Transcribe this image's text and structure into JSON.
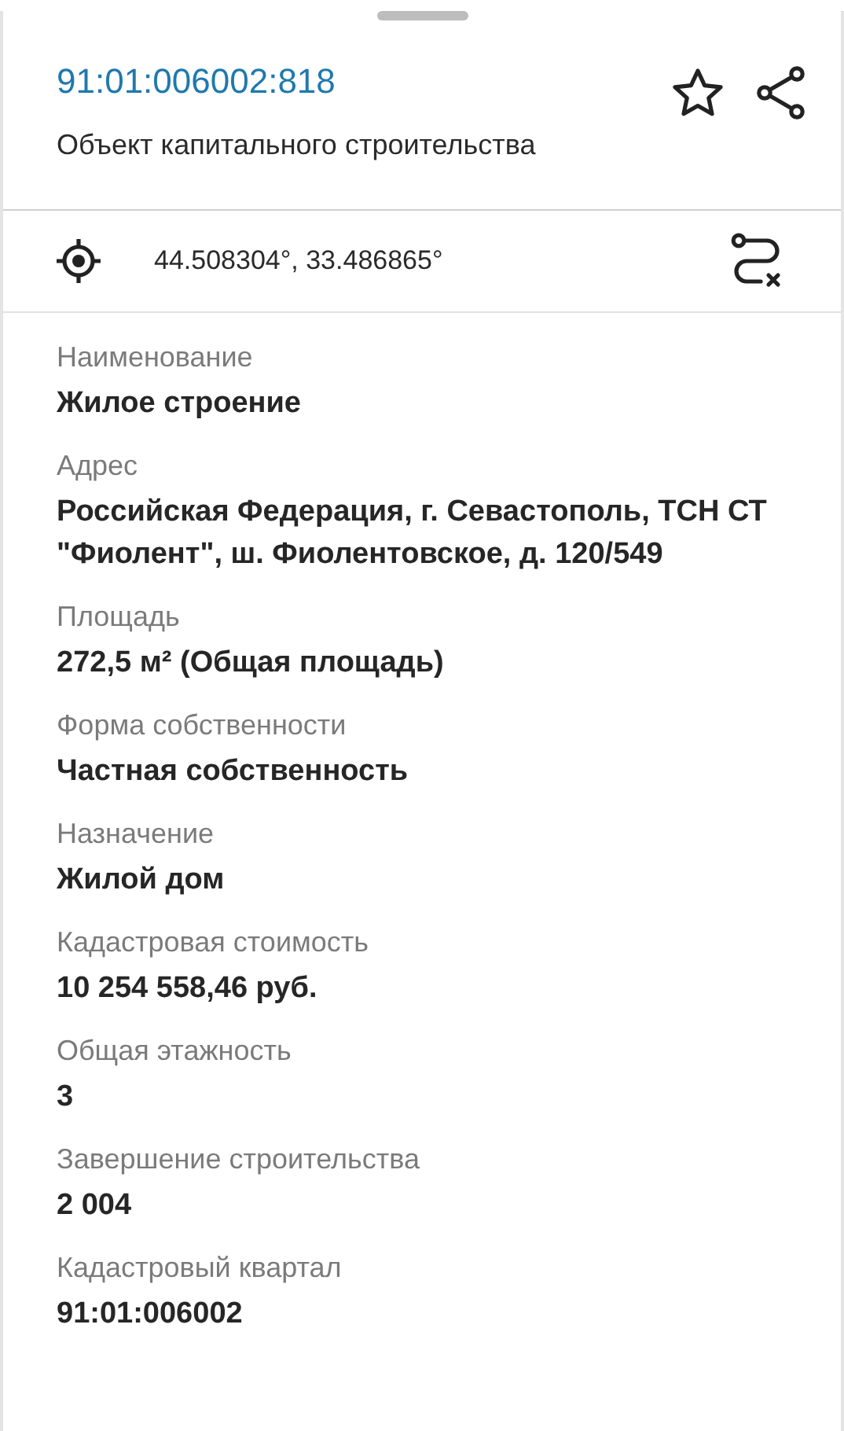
{
  "header": {
    "cadastral_number": "91:01:006002:818",
    "object_type": "Объект капитального строительства"
  },
  "coordinates": "44.508304°, 33.486865°",
  "fields": [
    {
      "label": "Наименование",
      "value": "Жилое строение"
    },
    {
      "label": "Адрес",
      "value": "Российская Федерация, г. Севастополь, ТСН СТ \"Фиолент\", ш. Фиолентовское, д. 120/549"
    },
    {
      "label": "Площадь",
      "value": "272,5 м² (Общая площадь)"
    },
    {
      "label": "Форма собственности",
      "value": "Частная собственность"
    },
    {
      "label": "Назначение",
      "value": "Жилой дом"
    },
    {
      "label": "Кадастровая стоимость",
      "value": "10 254 558,46 руб."
    },
    {
      "label": "Общая этажность",
      "value": "3"
    },
    {
      "label": "Завершение строительства",
      "value": "2 004"
    },
    {
      "label": "Кадастровый квартал",
      "value": "91:01:006002"
    }
  ]
}
